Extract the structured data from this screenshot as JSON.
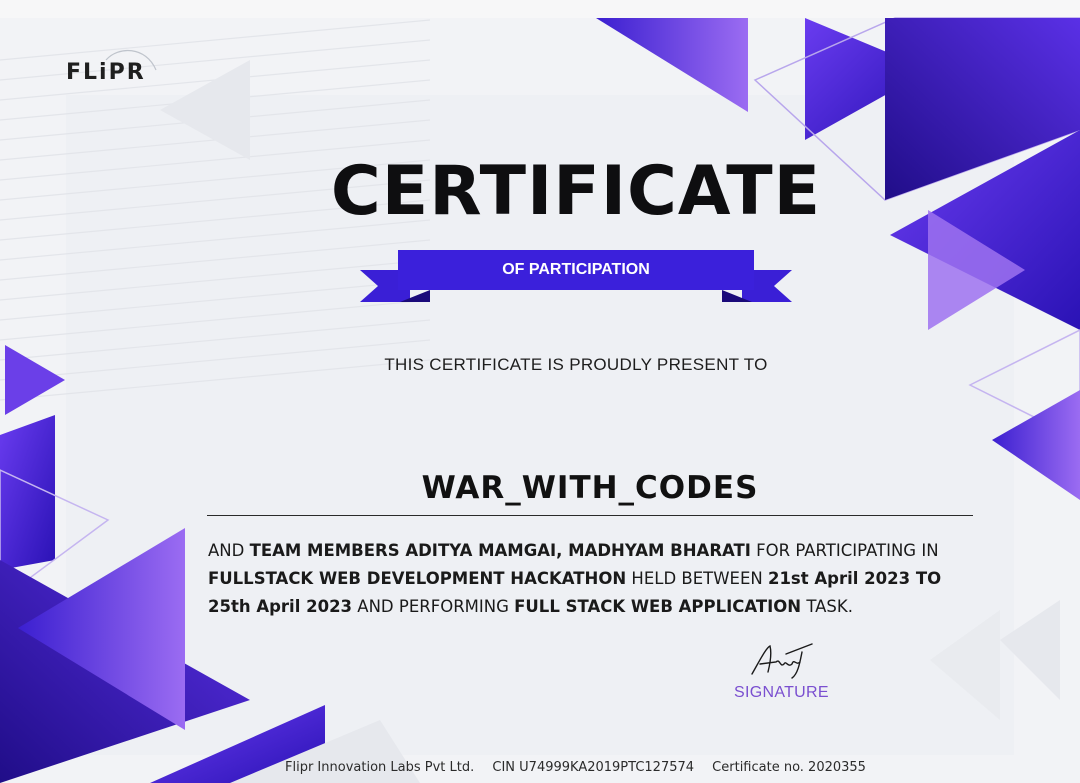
{
  "logo": {
    "text": "FLiPR"
  },
  "certificate": {
    "title": "CERTIFICATE",
    "ribbon": "OF PARTICIPATION",
    "presented_to": "THIS CERTIFICATE IS PROUDLY PRESENT TO",
    "team_name": "WAR_WITH_CODES",
    "body": {
      "p1": "AND ",
      "b1": "TEAM MEMBERS ADITYA MAMGAI, MADHYAM BHARATI",
      "p2": " FOR PARTICIPATING IN ",
      "b2": "FULLSTACK WEB DEVELOPMENT HACKATHON",
      "p3": " HELD BETWEEN ",
      "b3": "21st April 2023 TO 25th April 2023",
      "p4": " AND PERFORMING ",
      "b4": "FULL STACK WEB APPLICATION",
      "p5": " TASK."
    },
    "signature_script": "Anuj",
    "signature_label": "SIGNATURE"
  },
  "footer": {
    "company": "Flipr Innovation Labs Pvt Ltd.",
    "cin": "CIN U74999KA2019PTC127574",
    "cert_no": "Certificate no. 2020355"
  },
  "colors": {
    "purple_dark": "#2a0fa8",
    "purple_mid": "#5b2ee0",
    "purple_light": "#8b5cf0",
    "ribbon": "#3a1fd6",
    "signature_label": "#7a4fd0"
  }
}
